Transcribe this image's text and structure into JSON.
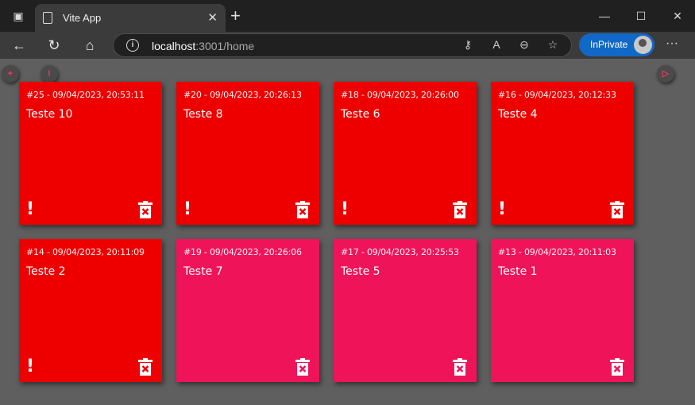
{
  "browser": {
    "tab_title": "Vite App",
    "url_host": "localhost",
    "url_rest": ":3001/home",
    "inprivate_label": "InPrivate"
  },
  "app": {
    "colors": {
      "priority": "#ee0000",
      "normal": "#ef145a"
    },
    "notes": [
      {
        "meta": "#25 - 09/04/2023, 20:53:11",
        "title": "Teste 10",
        "priority": true
      },
      {
        "meta": "#20 - 09/04/2023, 20:26:13",
        "title": "Teste 8",
        "priority": true
      },
      {
        "meta": "#18 - 09/04/2023, 20:26:00",
        "title": "Teste 6",
        "priority": true
      },
      {
        "meta": "#16 - 09/04/2023, 20:12:33",
        "title": "Teste 4",
        "priority": true
      },
      {
        "meta": "#14 - 09/04/2023, 20:11:09",
        "title": "Teste 2",
        "priority": true
      },
      {
        "meta": "#19 - 09/04/2023, 20:26:06",
        "title": "Teste 7",
        "priority": false
      },
      {
        "meta": "#17 - 09/04/2023, 20:25:53",
        "title": "Teste 5",
        "priority": false
      },
      {
        "meta": "#13 - 09/04/2023, 20:11:03",
        "title": "Teste 1",
        "priority": false
      }
    ]
  }
}
